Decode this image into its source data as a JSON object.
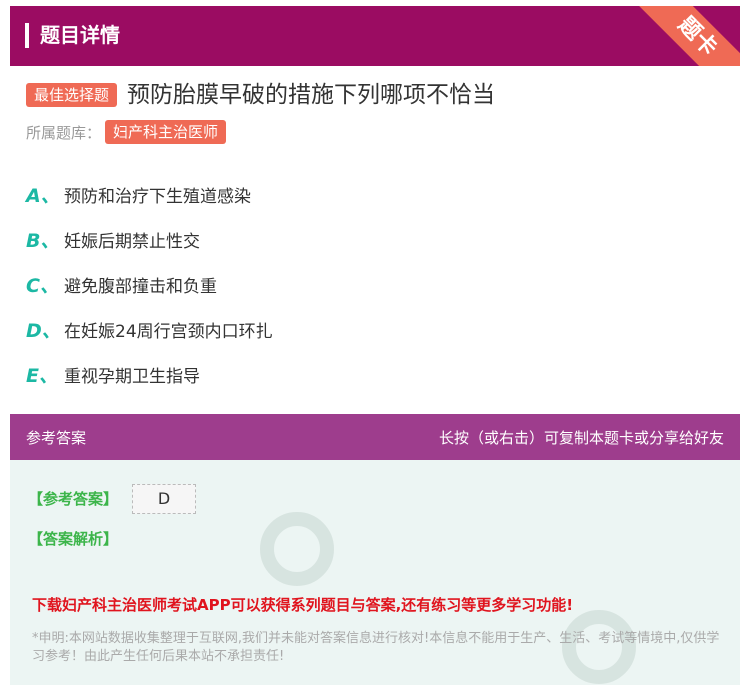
{
  "header": {
    "title": "题目详情",
    "ribbon": "题卡"
  },
  "question": {
    "type_badge": "最佳选择题",
    "text": "预防胎膜早破的措施下列哪项不恰当",
    "bank_label": "所属题库：",
    "bank_name": "妇产科主治医师"
  },
  "options": [
    {
      "letter": "A、",
      "text": "预防和治疗下生殖道感染"
    },
    {
      "letter": "B、",
      "text": "妊娠后期禁止性交"
    },
    {
      "letter": "C、",
      "text": "避免腹部撞击和负重"
    },
    {
      "letter": "D、",
      "text": "在妊娠24周行宫颈内口环扎"
    },
    {
      "letter": "E、",
      "text": "重视孕期卫生指导"
    }
  ],
  "answer_bar": {
    "left": "参考答案",
    "right": "长按（或右击）可复制本题卡或分享给好友"
  },
  "answer": {
    "answer_label": "【参考答案】",
    "answer_value": "D",
    "analysis_label": "【答案解析】",
    "promo": "下载妇产科主治医师考试APP可以获得系列题目与答案,还有练习等更多学习功能!",
    "disclaimer": "*申明:本网站数据收集整理于互联网,我们并未能对答案信息进行核对!本信息不能用于生产、生活、考试等情境中,仅供学习参考！由此产生任何后果本站不承担责任!"
  },
  "colors": {
    "header": "#9b0c62",
    "accent": "#ef6a55",
    "option_letter": "#1cb8a4",
    "answer_bar": "#9e3d8d"
  }
}
